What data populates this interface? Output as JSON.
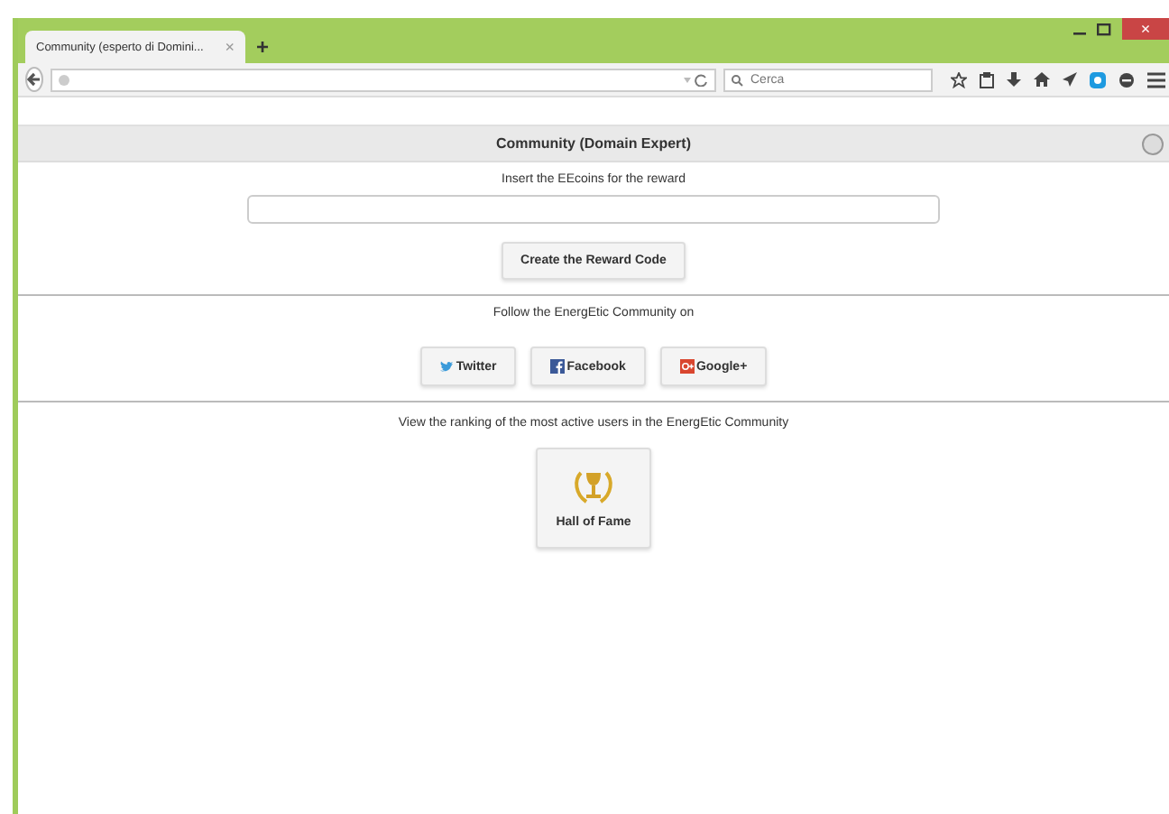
{
  "browser": {
    "tab_title": "Community (esperto di Domini...",
    "tab_close": "×",
    "new_tab": "+",
    "search_placeholder": "Cerca",
    "window_close": "×"
  },
  "page": {
    "title": "Community (Domain Expert)",
    "reward": {
      "label": "Insert the EEcoins for the reward",
      "button": "Create the Reward Code"
    },
    "follow": {
      "label": "Follow the EnergEtic Community on",
      "buttons": [
        {
          "kind": "twitter",
          "label": "Twitter"
        },
        {
          "kind": "facebook",
          "label": "Facebook"
        },
        {
          "kind": "google",
          "label": "Google+"
        }
      ]
    },
    "ranking": {
      "label": "View the ranking of the most active users in the EnergEtic Community",
      "button": "Hall of Fame"
    }
  }
}
